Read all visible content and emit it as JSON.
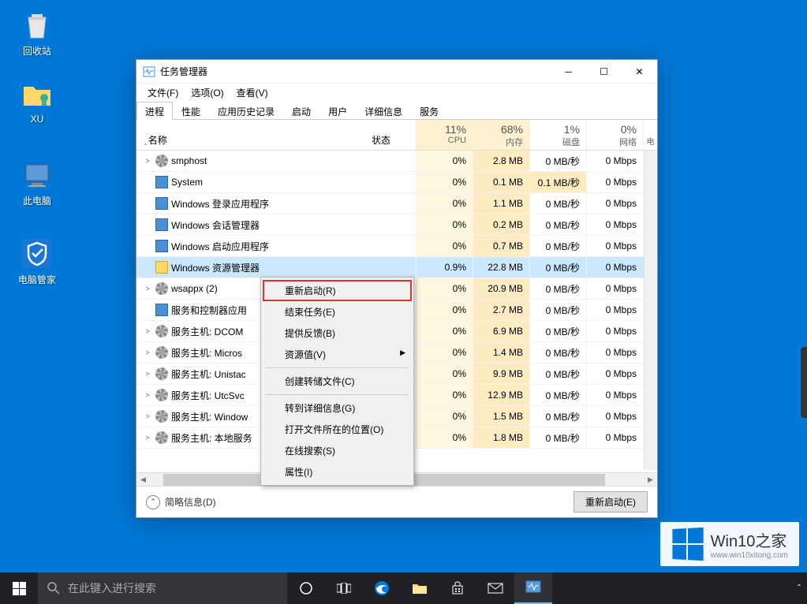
{
  "desktop": {
    "icons": [
      {
        "label": "回收站"
      },
      {
        "label": "XU"
      },
      {
        "label": "此电脑"
      },
      {
        "label": "电脑管家"
      }
    ]
  },
  "taskmgr": {
    "title": "任务管理器",
    "menu": {
      "file": "文件(F)",
      "options": "选项(O)",
      "view": "查看(V)"
    },
    "tabs": [
      "进程",
      "性能",
      "应用历史记录",
      "启动",
      "用户",
      "详细信息",
      "服务"
    ],
    "columns": {
      "name": "名称",
      "status": "状态",
      "cpu": {
        "pct": "11%",
        "label": "CPU"
      },
      "mem": {
        "pct": "68%",
        "label": "内存"
      },
      "disk": {
        "pct": "1%",
        "label": "磁盘"
      },
      "net": {
        "pct": "0%",
        "label": "网络"
      },
      "extra": "电"
    },
    "rows": [
      {
        "exp": ">",
        "name": "smphost",
        "cpu": "0%",
        "mem": "2.8 MB",
        "disk": "0 MB/秒",
        "net": "0 Mbps",
        "type": "gear"
      },
      {
        "exp": "",
        "name": "System",
        "cpu": "0%",
        "mem": "0.1 MB",
        "disk": "0.1 MB/秒",
        "net": "0 Mbps",
        "type": "app",
        "diskheat": true
      },
      {
        "exp": "",
        "name": "Windows 登录应用程序",
        "cpu": "0%",
        "mem": "1.1 MB",
        "disk": "0 MB/秒",
        "net": "0 Mbps",
        "type": "app"
      },
      {
        "exp": "",
        "name": "Windows 会话管理器",
        "cpu": "0%",
        "mem": "0.2 MB",
        "disk": "0 MB/秒",
        "net": "0 Mbps",
        "type": "app"
      },
      {
        "exp": "",
        "name": "Windows 启动应用程序",
        "cpu": "0%",
        "mem": "0.7 MB",
        "disk": "0 MB/秒",
        "net": "0 Mbps",
        "type": "app"
      },
      {
        "exp": "",
        "name": "Windows 资源管理器",
        "cpu": "0.9%",
        "mem": "22.8 MB",
        "disk": "0 MB/秒",
        "net": "0 Mbps",
        "type": "folder",
        "selected": true
      },
      {
        "exp": ">",
        "name": "wsappx (2)",
        "cpu": "0%",
        "mem": "20.9 MB",
        "disk": "0 MB/秒",
        "net": "0 Mbps",
        "type": "gear"
      },
      {
        "exp": "",
        "name": "服务和控制器应用",
        "cpu": "0%",
        "mem": "2.7 MB",
        "disk": "0 MB/秒",
        "net": "0 Mbps",
        "type": "app",
        "trunc": true
      },
      {
        "exp": ">",
        "name": "服务主机: DCOM",
        "cpu": "0%",
        "mem": "6.9 MB",
        "disk": "0 MB/秒",
        "net": "0 Mbps",
        "type": "gear",
        "trunc": true
      },
      {
        "exp": ">",
        "name": "服务主机: Micros",
        "cpu": "0%",
        "mem": "1.4 MB",
        "disk": "0 MB/秒",
        "net": "0 Mbps",
        "type": "gear",
        "trunc": true
      },
      {
        "exp": ">",
        "name": "服务主机: Unistac",
        "cpu": "0%",
        "mem": "9.9 MB",
        "disk": "0 MB/秒",
        "net": "0 Mbps",
        "type": "gear",
        "trunc": true
      },
      {
        "exp": ">",
        "name": "服务主机: UtcSvc",
        "cpu": "0%",
        "mem": "12.9 MB",
        "disk": "0 MB/秒",
        "net": "0 Mbps",
        "type": "gear",
        "trunc": true
      },
      {
        "exp": ">",
        "name": "服务主机: Window",
        "cpu": "0%",
        "mem": "1.5 MB",
        "disk": "0 MB/秒",
        "net": "0 Mbps",
        "type": "gear",
        "trunc": true
      },
      {
        "exp": ">",
        "name": "服务主机: 本地服务",
        "cpu": "0%",
        "mem": "1.8 MB",
        "disk": "0 MB/秒",
        "net": "0 Mbps",
        "type": "gear",
        "trunc": true
      }
    ],
    "footer": {
      "fewer": "简略信息(D)",
      "button": "重新启动(E)"
    }
  },
  "contextmenu": {
    "items": [
      {
        "label": "重新启动(R)",
        "hl": true
      },
      {
        "label": "结束任务(E)"
      },
      {
        "label": "提供反馈(B)"
      },
      {
        "label": "资源值(V)",
        "sub": true
      },
      {
        "sep": true
      },
      {
        "label": "创建转储文件(C)"
      },
      {
        "sep": true
      },
      {
        "label": "转到详细信息(G)"
      },
      {
        "label": "打开文件所在的位置(O)"
      },
      {
        "label": "在线搜索(S)"
      },
      {
        "label": "属性(I)"
      }
    ]
  },
  "taskbar": {
    "search_placeholder": "在此键入进行搜索"
  },
  "watermark": {
    "brand": "Win10",
    "suffix": "之家",
    "url": "www.win10xitong.com"
  }
}
